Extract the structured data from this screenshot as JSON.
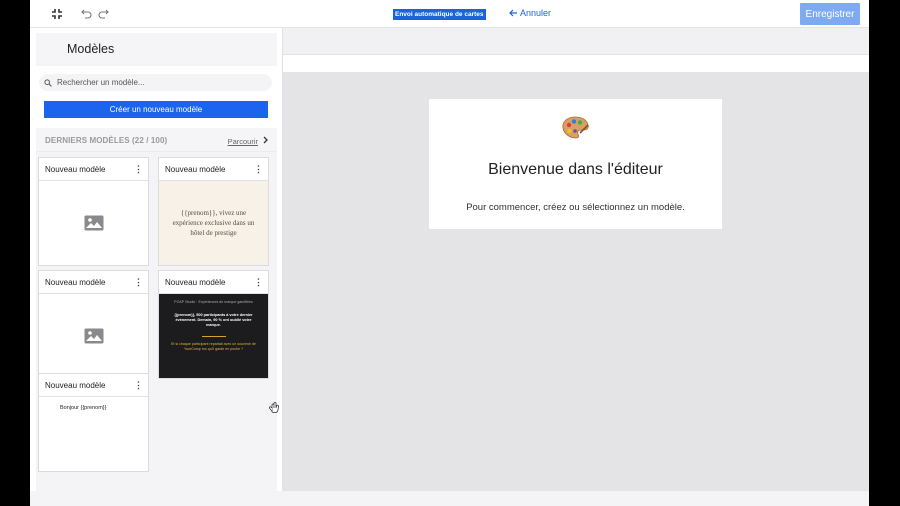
{
  "toolbar": {
    "exit_icon": "collapse-arrows-icon",
    "undo_icon": "undo-icon",
    "redo_icon": "redo-icon",
    "badge": "Envoi automatique de cartes",
    "cancel_label": "Annuler",
    "save_label": "Enregistrer"
  },
  "panel": {
    "title": "Modèles",
    "search_placeholder": "Rechercher un modèle...",
    "create_label": "Créer un nouveau modèle",
    "recent_title": "DERNIERS MODÈLES (22 / 100)",
    "browse_label": "Parcourir"
  },
  "templates": [
    {
      "name": "Nouveau modèle",
      "preview": "placeholder"
    },
    {
      "name": "Nouveau modèle",
      "preview": "beige",
      "text": "{{prenom}}, vivez une expérience exclusive dans un hôtel de prestige"
    },
    {
      "name": "Nouveau modèle",
      "preview": "placeholder"
    },
    {
      "name": "Nouveau modèle",
      "preview": "dark",
      "line1": "POAP Studio · Expériences de marque gamifiées",
      "line2": "{{prenom}}, 500 participants à votre dernier évènement. Demain, 90 % ont oublié votre marque.",
      "line3": "Et si chaque participant repartait avec un souvenir de YourComp mo qu'il garde en poche ?"
    },
    {
      "name": "Nouveau modèle",
      "preview": "white",
      "text": "Bonjour {{prenom}}"
    }
  ],
  "welcome": {
    "icon": "artist-palette-icon",
    "title": "Bienvenue dans l'éditeur",
    "text": "Pour commencer, créez ou sélectionnez un modèle."
  },
  "colors": {
    "accent": "#1a64ee",
    "save_disabled": "#7eaaf2",
    "canvas_bg": "#e4e4e6"
  }
}
